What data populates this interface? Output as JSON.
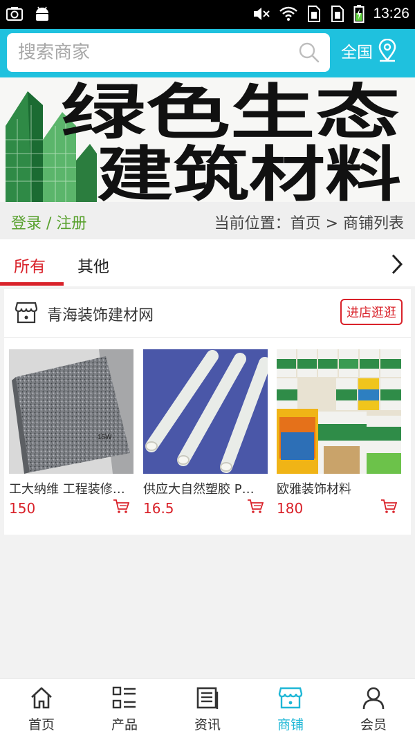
{
  "status_bar": {
    "time": "13:26"
  },
  "search": {
    "placeholder": "搜索商家"
  },
  "region": {
    "label": "全国"
  },
  "banner": {
    "line1": "绿色生态",
    "line2": "建筑材料"
  },
  "breadcrumb": {
    "login_label": "登录 / 注册",
    "trail": "当前位置：首页 > 商铺列表"
  },
  "tabs": [
    {
      "label": "所有",
      "active": true
    },
    {
      "label": "其他",
      "active": false
    }
  ],
  "store": {
    "name": "青海装饰建材网",
    "visit_label": "进店逛逛",
    "products": [
      {
        "name": "工大纳维 工程装修地面砖",
        "price": "150"
      },
      {
        "name": "供应大自然塑胶 PVC管",
        "price": "16.5"
      },
      {
        "name": "欧雅装饰材料",
        "price": "180"
      }
    ]
  },
  "bottom_nav": [
    {
      "label": "首页",
      "icon": "home-icon"
    },
    {
      "label": "产品",
      "icon": "list-icon"
    },
    {
      "label": "资讯",
      "icon": "news-icon"
    },
    {
      "label": "商铺",
      "icon": "shop-icon",
      "active": true
    },
    {
      "label": "会员",
      "icon": "user-icon"
    }
  ],
  "colors": {
    "header": "#1fc1de",
    "accent_red": "#d9222a",
    "login_green": "#58a12e",
    "nav_active": "#1fb7d6"
  }
}
